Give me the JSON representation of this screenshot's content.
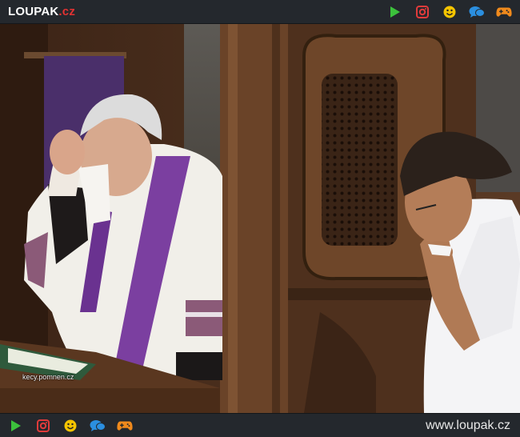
{
  "header": {
    "logo_brand": "LOUPAK",
    "logo_tld": ".cz"
  },
  "icons": [
    {
      "name": "play-icon",
      "color": "#3cc23c"
    },
    {
      "name": "instagram-icon",
      "color": "#e03b3b"
    },
    {
      "name": "smiley-icon",
      "color": "#f4c400"
    },
    {
      "name": "chat-icon",
      "color": "#2b8fe0"
    },
    {
      "name": "gamepad-icon",
      "color": "#f08a1c"
    }
  ],
  "photo": {
    "watermark": "kecy.pomnen.cz"
  },
  "footer": {
    "site_url": "www.loupak.cz"
  }
}
